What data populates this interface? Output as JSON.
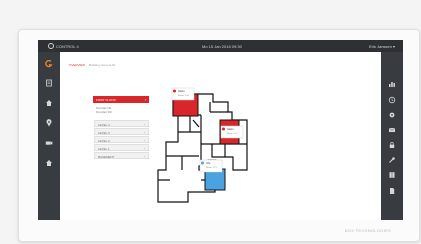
{
  "topbar": {
    "brand": "CONTROL 4",
    "datetime": "Mo 15 Jan 2018 09:30",
    "user": "Erik Janssen ▾"
  },
  "breadcrumb": {
    "active": "OVERVIEW",
    "sub": "Building Geneva NL"
  },
  "floors": {
    "selected": "FIRST FLOOR",
    "sub_items": [
      "Floorplan NE",
      "Floorplan SW"
    ],
    "levels": [
      "LEVEL 4",
      "LEVEL 3",
      "LEVEL 2",
      "LEVEL 1",
      "BASEMENT"
    ]
  },
  "map_callouts": [
    {
      "title": "Alarm",
      "text": "Room 1.04"
    },
    {
      "title": "Alarm",
      "text": "Room 1.12"
    },
    {
      "title": "Info",
      "text": "Room 1.21"
    }
  ],
  "colors": {
    "alarm": "#d8262a",
    "info": "#4aa3df",
    "nav_bg": "#383b3f"
  },
  "left_nav_icons": [
    "logo-icon",
    "list-icon",
    "home-icon",
    "location-icon",
    "camera-icon",
    "home-icon"
  ],
  "right_nav_icons": [
    "chart-icon",
    "clock-icon",
    "settings-icon",
    "mail-icon",
    "lock-icon",
    "wrench-icon",
    "book-icon",
    "document-icon"
  ],
  "bezel": {
    "brand": "BOX TECHNOLOGIES"
  }
}
